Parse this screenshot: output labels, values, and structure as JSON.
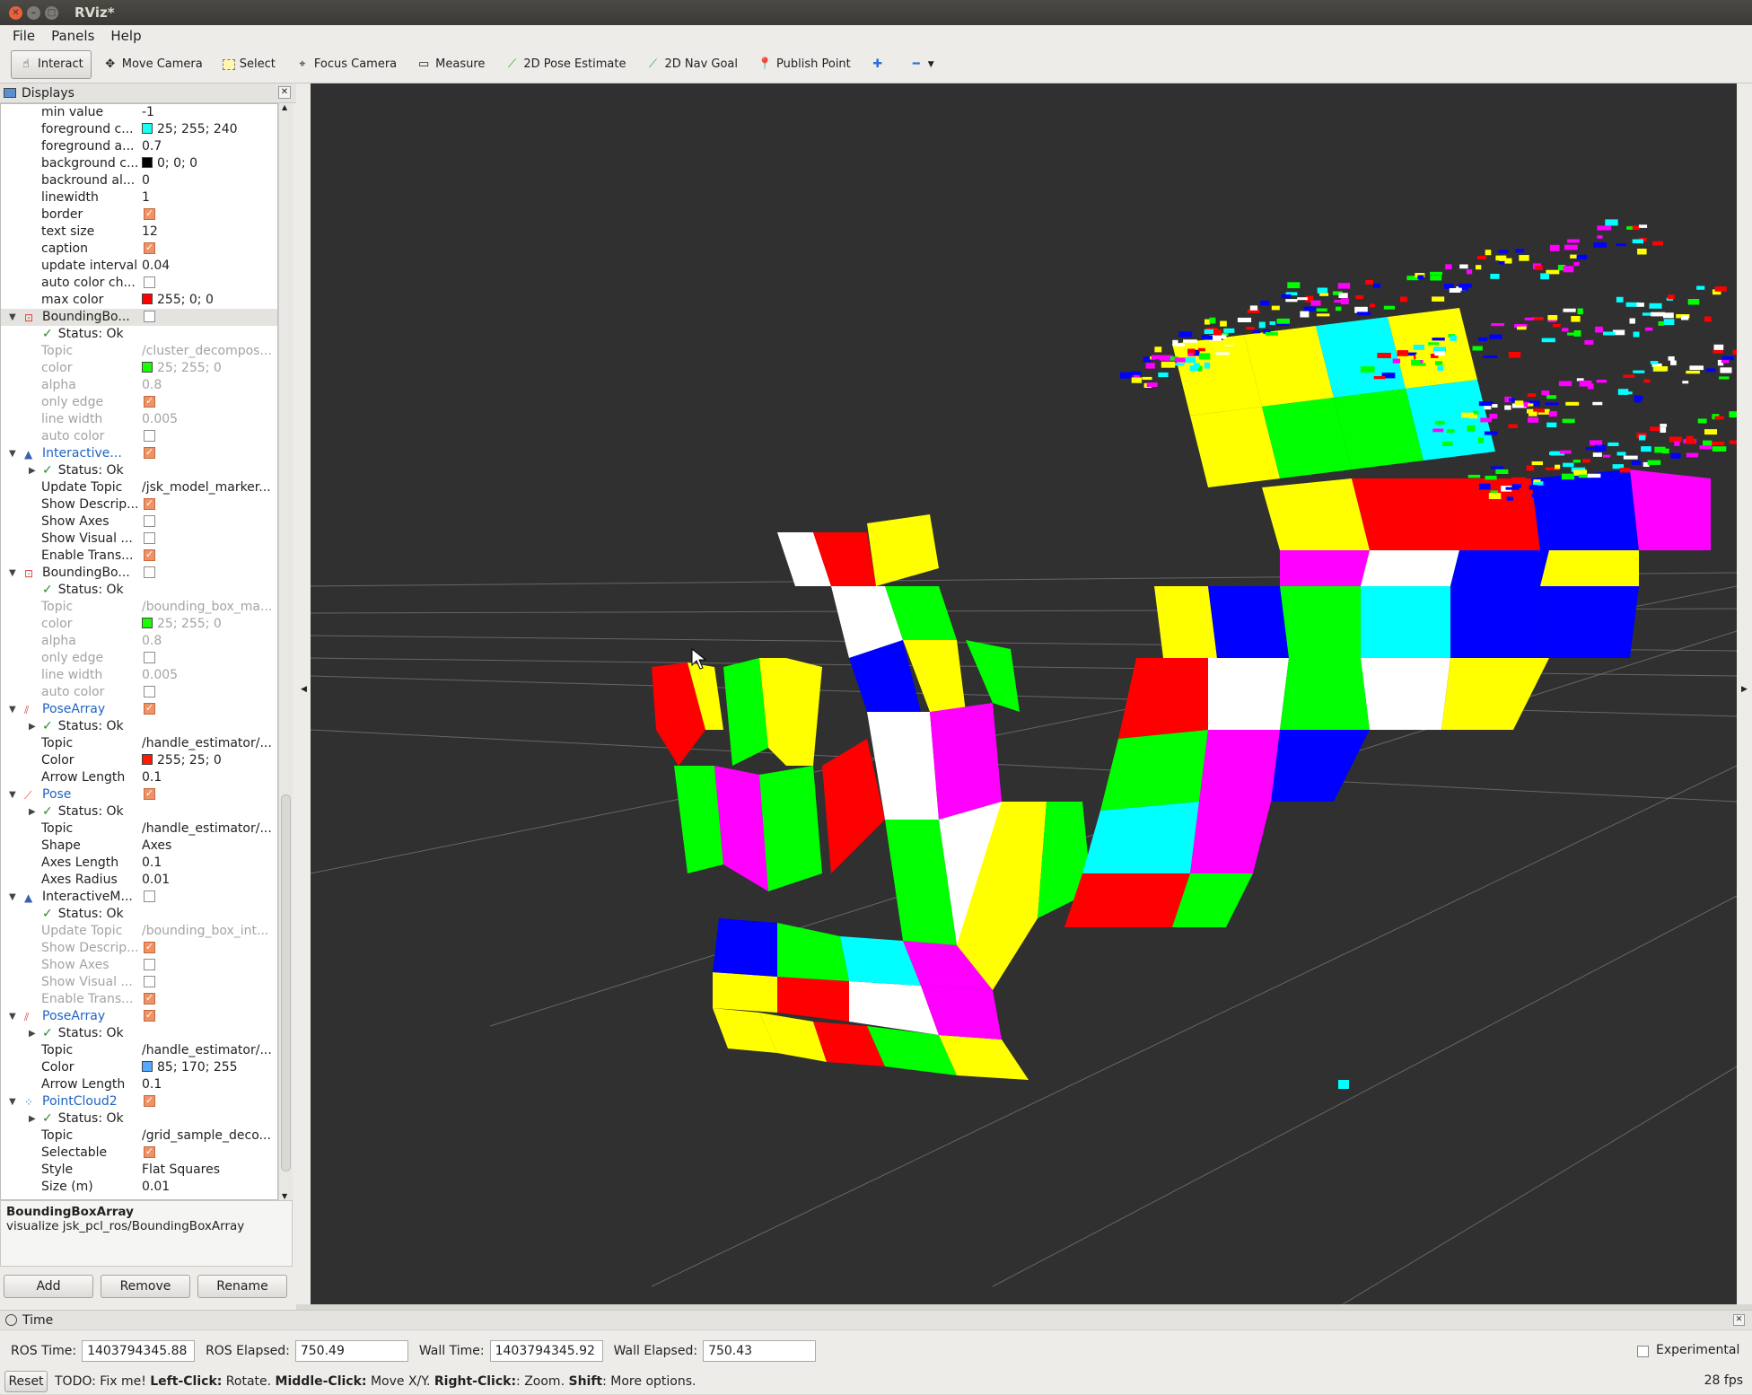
{
  "window": {
    "title": "RViz*"
  },
  "menu": [
    "File",
    "Panels",
    "Help"
  ],
  "toolbar": [
    {
      "label": "Interact",
      "icon": "hand-icon",
      "active": true
    },
    {
      "label": "Move Camera",
      "icon": "move-camera-icon"
    },
    {
      "label": "Select",
      "icon": "select-icon"
    },
    {
      "label": "Focus Camera",
      "icon": "focus-camera-icon"
    },
    {
      "label": "Measure",
      "icon": "measure-icon"
    },
    {
      "label": "2D Pose Estimate",
      "icon": "pose-estimate-icon"
    },
    {
      "label": "2D Nav Goal",
      "icon": "nav-goal-icon"
    },
    {
      "label": "Publish Point",
      "icon": "publish-point-icon"
    }
  ],
  "displays": {
    "title": "Displays",
    "rows": [
      {
        "k": "min value",
        "v": "-1",
        "i": 1
      },
      {
        "k": "foreground c...",
        "v": "25; 255; 240",
        "sw": "#19fff0",
        "i": 1
      },
      {
        "k": "foreground a...",
        "v": "0.7",
        "i": 1
      },
      {
        "k": "background c...",
        "v": "0; 0; 0",
        "sw": "#000000",
        "i": 1
      },
      {
        "k": "backround al...",
        "v": "0",
        "i": 1
      },
      {
        "k": "linewidth",
        "v": "1",
        "i": 1
      },
      {
        "k": "border",
        "chk": true,
        "i": 1
      },
      {
        "k": "text size",
        "v": "12",
        "i": 1
      },
      {
        "k": "caption",
        "chk": true,
        "i": 1
      },
      {
        "k": "update interval",
        "v": "0.04",
        "i": 1
      },
      {
        "k": "auto color ch...",
        "chk": false,
        "i": 1
      },
      {
        "k": "max color",
        "v": "255; 0; 0",
        "sw": "#ff0000",
        "i": 1
      },
      {
        "k": "BoundingBo...",
        "chk": false,
        "grp": true,
        "icon": "bbox",
        "sel": true
      },
      {
        "k": "Status: Ok",
        "status": true,
        "i": 1
      },
      {
        "k": "Topic",
        "v": "/cluster_decompos...",
        "dis": true,
        "i": 1
      },
      {
        "k": "color",
        "v": "25; 255; 0",
        "sw": "#19ff00",
        "dis": true,
        "i": 1
      },
      {
        "k": "alpha",
        "v": "0.8",
        "dis": true,
        "i": 1
      },
      {
        "k": "only edge",
        "chk": true,
        "dis": true,
        "i": 1
      },
      {
        "k": "line width",
        "v": "0.005",
        "dis": true,
        "i": 1
      },
      {
        "k": "auto color",
        "chk": false,
        "dis": true,
        "i": 1
      },
      {
        "k": "Interactive...",
        "chk": true,
        "grp": true,
        "icon": "im",
        "blue": true
      },
      {
        "k": "Status: Ok",
        "status": true,
        "i": 1,
        "exp": true
      },
      {
        "k": "Update Topic",
        "v": "/jsk_model_marker...",
        "i": 1
      },
      {
        "k": "Show Descrip...",
        "chk": true,
        "i": 1
      },
      {
        "k": "Show Axes",
        "chk": false,
        "i": 1
      },
      {
        "k": "Show Visual ...",
        "chk": false,
        "i": 1
      },
      {
        "k": "Enable Trans...",
        "chk": true,
        "i": 1
      },
      {
        "k": "BoundingBo...",
        "chk": false,
        "grp": true,
        "icon": "bbox"
      },
      {
        "k": "Status: Ok",
        "status": true,
        "i": 1
      },
      {
        "k": "Topic",
        "v": "/bounding_box_ma...",
        "dis": true,
        "i": 1
      },
      {
        "k": "color",
        "v": "25; 255; 0",
        "sw": "#19ff00",
        "dis": true,
        "i": 1
      },
      {
        "k": "alpha",
        "v": "0.8",
        "dis": true,
        "i": 1
      },
      {
        "k": "only edge",
        "chk": false,
        "dis": true,
        "i": 1
      },
      {
        "k": "line width",
        "v": "0.005",
        "dis": true,
        "i": 1
      },
      {
        "k": "auto color",
        "chk": false,
        "dis": true,
        "i": 1
      },
      {
        "k": "PoseArray",
        "chk": true,
        "grp": true,
        "icon": "posearray",
        "blue": true
      },
      {
        "k": "Status: Ok",
        "status": true,
        "i": 1,
        "exp": true
      },
      {
        "k": "Topic",
        "v": "/handle_estimator/...",
        "i": 1
      },
      {
        "k": "Color",
        "v": "255; 25; 0",
        "sw": "#ff1900",
        "i": 1
      },
      {
        "k": "Arrow Length",
        "v": "0.1",
        "i": 1
      },
      {
        "k": "Pose",
        "chk": true,
        "grp": true,
        "icon": "pose",
        "blue": true
      },
      {
        "k": "Status: Ok",
        "status": true,
        "i": 1,
        "exp": true
      },
      {
        "k": "Topic",
        "v": "/handle_estimator/...",
        "i": 1
      },
      {
        "k": "Shape",
        "v": "Axes",
        "i": 1
      },
      {
        "k": "Axes Length",
        "v": "0.1",
        "i": 1
      },
      {
        "k": "Axes Radius",
        "v": "0.01",
        "i": 1
      },
      {
        "k": "InteractiveM...",
        "chk": false,
        "grp": true,
        "icon": "im"
      },
      {
        "k": "Status: Ok",
        "status": true,
        "i": 1
      },
      {
        "k": "Update Topic",
        "v": "/bounding_box_int...",
        "dis": true,
        "i": 1
      },
      {
        "k": "Show Descrip...",
        "chk": true,
        "dis": true,
        "i": 1
      },
      {
        "k": "Show Axes",
        "chk": false,
        "dis": true,
        "i": 1
      },
      {
        "k": "Show Visual ...",
        "chk": false,
        "dis": true,
        "i": 1
      },
      {
        "k": "Enable Trans...",
        "chk": true,
        "dis": true,
        "i": 1
      },
      {
        "k": "PoseArray",
        "chk": true,
        "grp": true,
        "icon": "posearray",
        "blue": true
      },
      {
        "k": "Status: Ok",
        "status": true,
        "i": 1,
        "exp": true
      },
      {
        "k": "Topic",
        "v": "/handle_estimator/...",
        "i": 1
      },
      {
        "k": "Color",
        "v": "85; 170; 255",
        "sw": "#55aaff",
        "i": 1
      },
      {
        "k": "Arrow Length",
        "v": "0.1",
        "i": 1
      },
      {
        "k": "PointCloud2",
        "chk": true,
        "grp": true,
        "icon": "pc",
        "blue": true
      },
      {
        "k": "Status: Ok",
        "status": true,
        "i": 1,
        "exp": true
      },
      {
        "k": "Topic",
        "v": "/grid_sample_deco...",
        "i": 1
      },
      {
        "k": "Selectable",
        "chk": true,
        "i": 1
      },
      {
        "k": "Style",
        "v": "Flat Squares",
        "i": 1
      },
      {
        "k": "Size (m)",
        "v": "0.01",
        "i": 1
      }
    ]
  },
  "description": {
    "title": "BoundingBoxArray",
    "text": "visualize jsk_pcl_ros/BoundingBoxArray"
  },
  "buttons": {
    "add": "Add",
    "remove": "Remove",
    "rename": "Rename"
  },
  "time": {
    "title": "Time",
    "ros_time_label": "ROS Time:",
    "ros_time": "1403794345.88",
    "ros_elapsed_label": "ROS Elapsed:",
    "ros_elapsed": "750.49",
    "wall_time_label": "Wall Time:",
    "wall_time": "1403794345.92",
    "wall_elapsed_label": "Wall Elapsed:",
    "wall_elapsed": "750.43",
    "experimental": "Experimental"
  },
  "status": {
    "reset": "Reset",
    "todo": "TODO: Fix me! ",
    "left": "Left-Click:",
    "left_t": " Rotate. ",
    "middle": "Middle-Click:",
    "middle_t": " Move X/Y. ",
    "right": "Right-Click:",
    "right_t": ": Zoom. ",
    "shift": "Shift",
    "shift_t": ": More options.",
    "fps": "28 fps"
  },
  "colors": {
    "viewport": "#303030",
    "cloud": [
      "#ff0000",
      "#00ff00",
      "#0000ff",
      "#ffff00",
      "#ff00ff",
      "#00ffff",
      "#ffffff"
    ]
  }
}
